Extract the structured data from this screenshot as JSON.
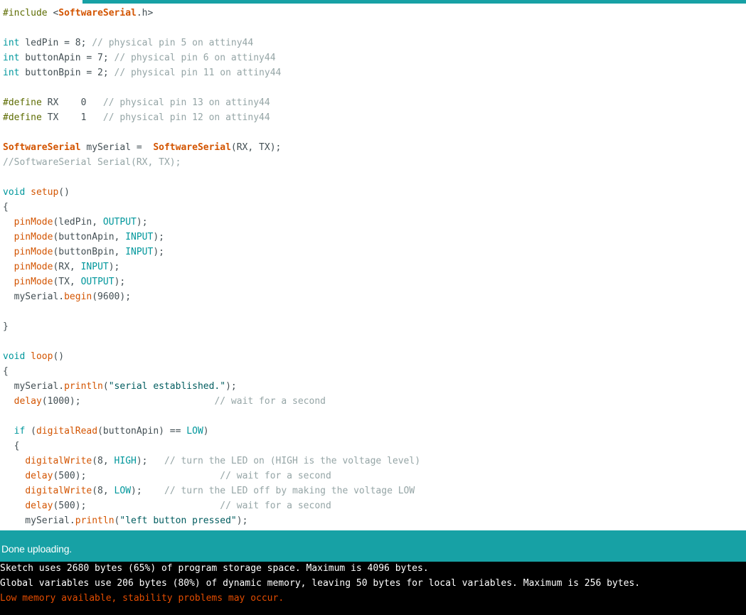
{
  "colors": {
    "accent": "#17A1A5",
    "editor_bg": "#FFFFFF",
    "console_bg": "#000000",
    "console_text": "#FFFFFF",
    "console_warning": "#E34C00",
    "status_text": "#FFFFFF",
    "plain": "#434F54",
    "comment": "#95A5A6",
    "preprocessor": "#5E6D03",
    "type_keyword": "#00979C",
    "function": "#D35400",
    "constant": "#00979C",
    "string": "#005C5F"
  },
  "editor": {
    "lines": [
      [
        [
          "preproc",
          "#include "
        ],
        [
          "plain",
          "<"
        ],
        [
          "include",
          "SoftwareSerial"
        ],
        [
          "plain",
          ".h>"
        ]
      ],
      [],
      [
        [
          "type",
          "int"
        ],
        [
          "plain",
          " ledPin = 8; "
        ],
        [
          "comment",
          "// physical pin 5 on attiny44"
        ]
      ],
      [
        [
          "type",
          "int"
        ],
        [
          "plain",
          " buttonApin = 7; "
        ],
        [
          "comment",
          "// physical pin 6 on attiny44"
        ]
      ],
      [
        [
          "type",
          "int"
        ],
        [
          "plain",
          " buttonBpin = 2; "
        ],
        [
          "comment",
          "// physical pin 11 on attiny44"
        ]
      ],
      [],
      [
        [
          "preproc",
          "#define"
        ],
        [
          "plain",
          " RX    0   "
        ],
        [
          "comment",
          "// physical pin 13 on attiny44"
        ]
      ],
      [
        [
          "preproc",
          "#define"
        ],
        [
          "plain",
          " TX    1   "
        ],
        [
          "comment",
          "// physical pin 12 on attiny44"
        ]
      ],
      [],
      [
        [
          "classname",
          "SoftwareSerial"
        ],
        [
          "plain",
          " mySerial =  "
        ],
        [
          "classname",
          "SoftwareSerial"
        ],
        [
          "plain",
          "(RX, TX);"
        ]
      ],
      [
        [
          "comment",
          "//SoftwareSerial Serial(RX, TX);"
        ]
      ],
      [],
      [
        [
          "type",
          "void"
        ],
        [
          "plain",
          " "
        ],
        [
          "func",
          "setup"
        ],
        [
          "plain",
          "()"
        ]
      ],
      [
        [
          "plain",
          "{"
        ]
      ],
      [
        [
          "plain",
          "  "
        ],
        [
          "func",
          "pinMode"
        ],
        [
          "plain",
          "(ledPin, "
        ],
        [
          "const",
          "OUTPUT"
        ],
        [
          "plain",
          ");"
        ]
      ],
      [
        [
          "plain",
          "  "
        ],
        [
          "func",
          "pinMode"
        ],
        [
          "plain",
          "(buttonApin, "
        ],
        [
          "const",
          "INPUT"
        ],
        [
          "plain",
          ");"
        ]
      ],
      [
        [
          "plain",
          "  "
        ],
        [
          "func",
          "pinMode"
        ],
        [
          "plain",
          "(buttonBpin, "
        ],
        [
          "const",
          "INPUT"
        ],
        [
          "plain",
          ");"
        ]
      ],
      [
        [
          "plain",
          "  "
        ],
        [
          "func",
          "pinMode"
        ],
        [
          "plain",
          "(RX, "
        ],
        [
          "const",
          "INPUT"
        ],
        [
          "plain",
          ");"
        ]
      ],
      [
        [
          "plain",
          "  "
        ],
        [
          "func",
          "pinMode"
        ],
        [
          "plain",
          "(TX, "
        ],
        [
          "const",
          "OUTPUT"
        ],
        [
          "plain",
          ");"
        ]
      ],
      [
        [
          "plain",
          "  mySerial."
        ],
        [
          "func",
          "begin"
        ],
        [
          "plain",
          "(9600);"
        ]
      ],
      [],
      [
        [
          "plain",
          "}"
        ]
      ],
      [],
      [
        [
          "type",
          "void"
        ],
        [
          "plain",
          " "
        ],
        [
          "func",
          "loop"
        ],
        [
          "plain",
          "()"
        ]
      ],
      [
        [
          "plain",
          "{"
        ]
      ],
      [
        [
          "plain",
          "  mySerial."
        ],
        [
          "func",
          "println"
        ],
        [
          "plain",
          "("
        ],
        [
          "string",
          "\"serial established.\""
        ],
        [
          "plain",
          ");"
        ]
      ],
      [
        [
          "plain",
          "  "
        ],
        [
          "func",
          "delay"
        ],
        [
          "plain",
          "(1000);                        "
        ],
        [
          "comment",
          "// wait for a second"
        ]
      ],
      [],
      [
        [
          "plain",
          "  "
        ],
        [
          "type",
          "if"
        ],
        [
          "plain",
          " ("
        ],
        [
          "func",
          "digitalRead"
        ],
        [
          "plain",
          "(buttonApin) == "
        ],
        [
          "const",
          "LOW"
        ],
        [
          "plain",
          ")"
        ]
      ],
      [
        [
          "plain",
          "  {"
        ]
      ],
      [
        [
          "plain",
          "    "
        ],
        [
          "func",
          "digitalWrite"
        ],
        [
          "plain",
          "(8, "
        ],
        [
          "const",
          "HIGH"
        ],
        [
          "plain",
          ");   "
        ],
        [
          "comment",
          "// turn the LED on (HIGH is the voltage level)"
        ]
      ],
      [
        [
          "plain",
          "    "
        ],
        [
          "func",
          "delay"
        ],
        [
          "plain",
          "(500);                        "
        ],
        [
          "comment",
          "// wait for a second"
        ]
      ],
      [
        [
          "plain",
          "    "
        ],
        [
          "func",
          "digitalWrite"
        ],
        [
          "plain",
          "(8, "
        ],
        [
          "const",
          "LOW"
        ],
        [
          "plain",
          ");    "
        ],
        [
          "comment",
          "// turn the LED off by making the voltage LOW"
        ]
      ],
      [
        [
          "plain",
          "    "
        ],
        [
          "func",
          "delay"
        ],
        [
          "plain",
          "(500);                        "
        ],
        [
          "comment",
          "// wait for a second"
        ]
      ],
      [
        [
          "plain",
          "    mySerial."
        ],
        [
          "func",
          "println"
        ],
        [
          "plain",
          "("
        ],
        [
          "string",
          "\"left button pressed\""
        ],
        [
          "plain",
          ");"
        ]
      ]
    ]
  },
  "status": {
    "message": "Done uploading."
  },
  "console": {
    "lines": [
      {
        "text": "Sketch uses 2680 bytes (65%) of program storage space. Maximum is 4096 bytes.",
        "kind": "normal"
      },
      {
        "text": "Global variables use 206 bytes (80%) of dynamic memory, leaving 50 bytes for local variables. Maximum is 256 bytes.",
        "kind": "normal"
      },
      {
        "text": "Low memory available, stability problems may occur.",
        "kind": "warning"
      }
    ]
  }
}
